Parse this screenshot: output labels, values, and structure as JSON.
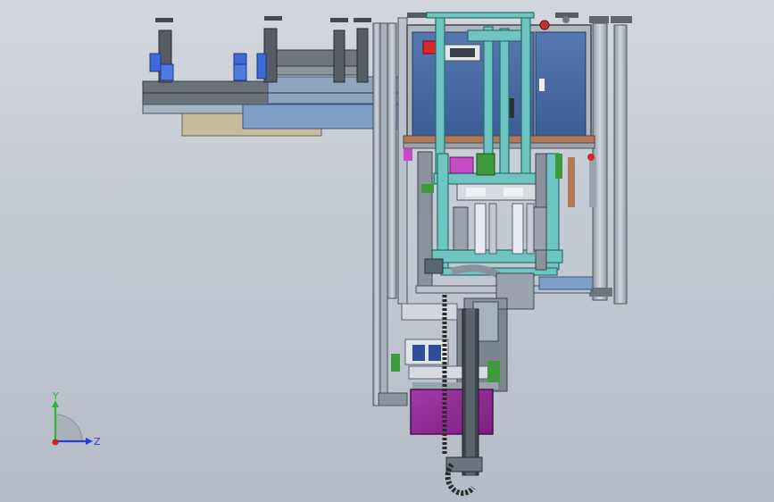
{
  "viewport": {
    "background_top": "#d3d7dd",
    "background_bottom": "#b4bcc7"
  },
  "triad": {
    "y_label": "Y",
    "z_label": "Z",
    "y_color": "#2eb82e",
    "z_color": "#2a3fd6",
    "x_color": "#d62020"
  },
  "colors": {
    "steel_light": "#c9ced6",
    "steel_mid": "#9aa3ad",
    "steel_dark": "#5c6670",
    "panel_blue": "#4a6ea8",
    "frame_blue": "#7f9ec3",
    "teal": "#6fc5c2",
    "purple": "#9a2a9a",
    "beige": "#c5bd9e",
    "copper": "#b07a5a",
    "cable": "#333333"
  }
}
